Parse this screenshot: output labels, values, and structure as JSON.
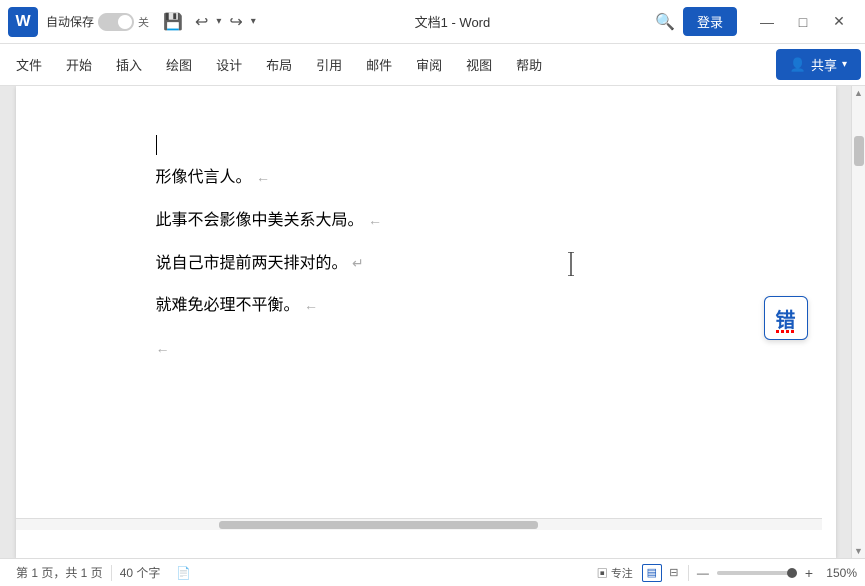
{
  "titlebar": {
    "logo_label": "W",
    "autosave_label": "自动保存",
    "toggle_state": "关",
    "save_icon": "💾",
    "undo_icon": "↩",
    "redo_icon": "↪",
    "dropdown_icon": "▼",
    "title": "文档1 - Word",
    "search_icon": "🔍",
    "login_label": "登录",
    "minimize_icon": "—",
    "maximize_icon": "□",
    "close_icon": "✕"
  },
  "menubar": {
    "items": [
      "文件",
      "开始",
      "插入",
      "绘图",
      "设计",
      "布局",
      "引用",
      "邮件",
      "审阅",
      "视图",
      "帮助"
    ],
    "share_label": "共享",
    "share_icon": "👤"
  },
  "document": {
    "paragraphs": [
      {
        "text": "",
        "pilcrow": "←",
        "indent": true
      },
      {
        "text": "形像代言人。",
        "pilcrow": "←",
        "indent": true
      },
      {
        "text": "此事不会影像中美关系大局。",
        "pilcrow": "←",
        "indent": true
      },
      {
        "text": "说自己市提前两天排对的。",
        "pilcrow": "↵",
        "indent": true,
        "has_cursor": false
      },
      {
        "text": "就难免必理不平衡。",
        "pilcrow": "←",
        "indent": true
      },
      {
        "text": "",
        "pilcrow": "←",
        "indent": true
      }
    ]
  },
  "spell_icon": {
    "label": "错"
  },
  "statusbar": {
    "page_info": "第 1 页，共 1 页",
    "word_count": "40 个字",
    "proofing_icon": "📄",
    "focus_label": "专注",
    "zoom_percent": "150%",
    "zoom_minus": "—",
    "zoom_plus": "+"
  }
}
